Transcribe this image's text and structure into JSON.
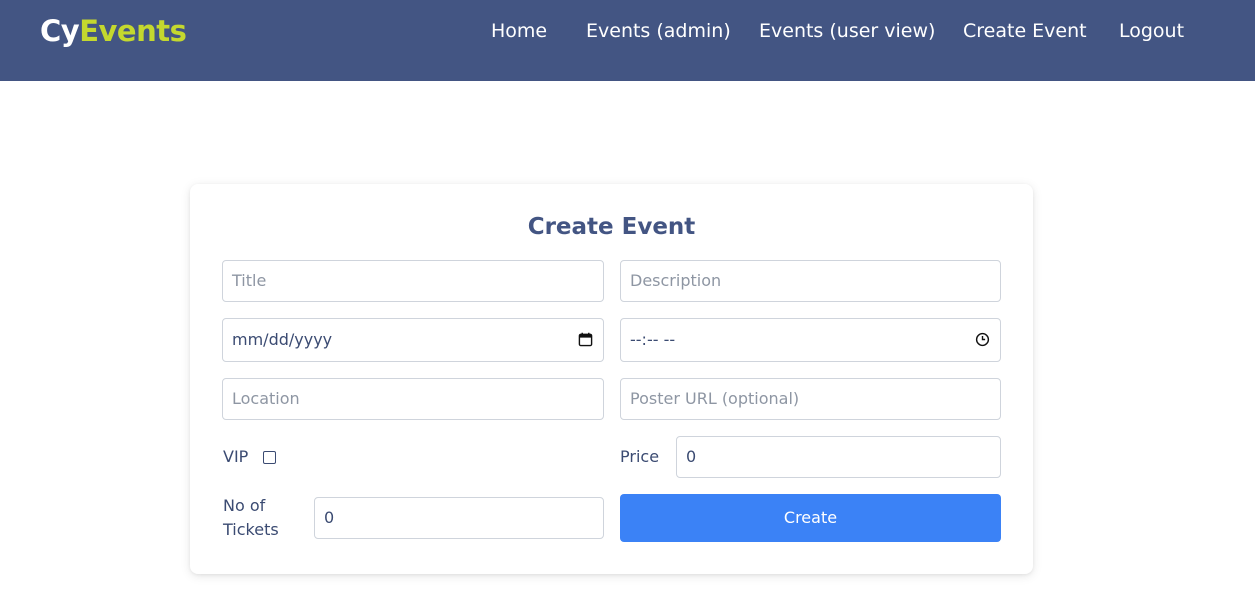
{
  "brand": {
    "part1": "Cy",
    "part2": "Events"
  },
  "nav": {
    "home": "Home",
    "events_admin": "Events (admin)",
    "events_user": "Events (user view)",
    "create_event": "Create Event",
    "logout": "Logout"
  },
  "form": {
    "title": "Create Event",
    "title_placeholder": "Title",
    "description_placeholder": "Description",
    "date_placeholder": "mm/dd/yyyy",
    "time_placeholder": "--:-- --",
    "location_placeholder": "Location",
    "poster_placeholder": "Poster URL (optional)",
    "vip_label": "VIP",
    "vip_checked": false,
    "price_label": "Price",
    "price_value": "0",
    "tickets_label_line1": "No of",
    "tickets_label_line2": "Tickets",
    "tickets_value": "0",
    "submit_label": "Create"
  },
  "colors": {
    "navbar": "#435583",
    "brand_accent": "#c4d82e",
    "primary_button": "#3b82f6",
    "heading": "#435583"
  },
  "icons": {
    "date": "calendar-icon",
    "time": "clock-icon"
  }
}
